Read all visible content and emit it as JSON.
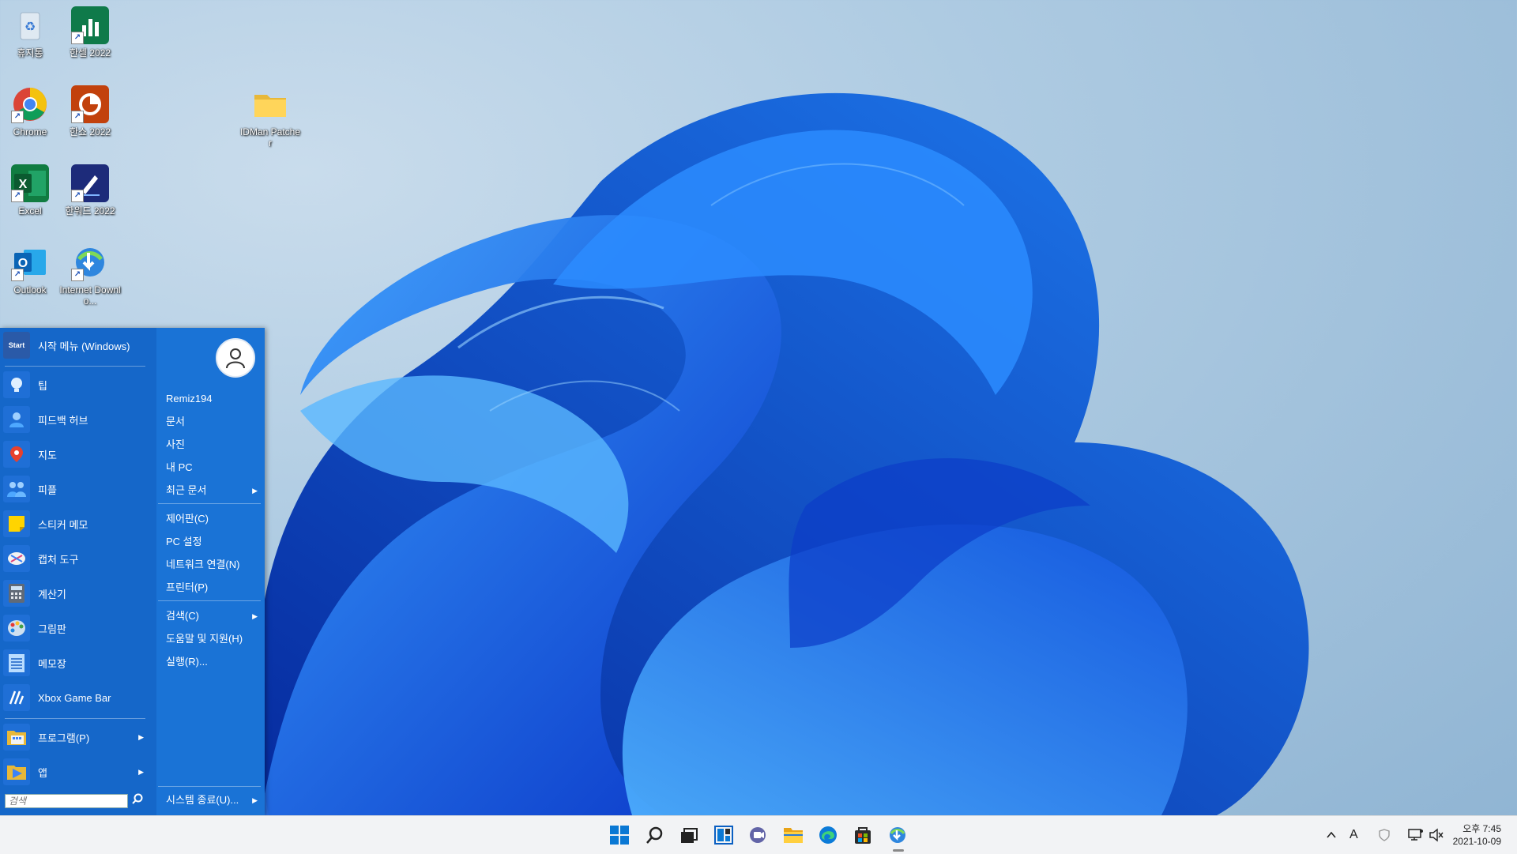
{
  "desktop": {
    "icons": [
      {
        "label": "휴지통",
        "icon": "recycle-bin-icon"
      },
      {
        "label": "한셀 2022",
        "icon": "hancell-icon"
      },
      {
        "label": "Chrome",
        "icon": "chrome-icon"
      },
      {
        "label": "한쇼 2022",
        "icon": "hanshow-icon"
      },
      {
        "label": "IDMan Patcher",
        "icon": "folder-icon"
      },
      {
        "label": "Excel",
        "icon": "excel-icon"
      },
      {
        "label": "한워드 2022",
        "icon": "hanword-icon"
      },
      {
        "label": "Outlook",
        "icon": "outlook-icon"
      },
      {
        "label": "Internet Downlo...",
        "icon": "idm-icon"
      }
    ]
  },
  "start_menu": {
    "header_label": "시작 메뉴 (Windows)",
    "header_icon_text": "Start",
    "apps": [
      {
        "label": "팁",
        "icon": "lightbulb-icon"
      },
      {
        "label": "피드백 허브",
        "icon": "feedback-person-icon"
      },
      {
        "label": "지도",
        "icon": "map-pin-icon"
      },
      {
        "label": "피플",
        "icon": "people-icon"
      },
      {
        "label": "스티커 메모",
        "icon": "sticky-note-icon"
      },
      {
        "label": "캡처 도구",
        "icon": "snipping-tool-icon"
      },
      {
        "label": "계산기",
        "icon": "calculator-icon"
      },
      {
        "label": "그림판",
        "icon": "paint-palette-icon"
      },
      {
        "label": "메모장",
        "icon": "notepad-icon"
      },
      {
        "label": "Xbox Game Bar",
        "icon": "xbox-game-bar-icon"
      }
    ],
    "programs_label": "프로그램(P)",
    "apps_label": "앱",
    "search_placeholder": "검색",
    "right_items": {
      "user": "Remiz194",
      "documents": "문서",
      "pictures": "사진",
      "my_pc": "내 PC",
      "recent_docs": "최근 문서",
      "control_panel": "제어판(C)",
      "pc_settings": "PC 설정",
      "network": "네트워크 연결(N)",
      "printers": "프린터(P)",
      "search": "검색(C)",
      "help": "도움말 및 지원(H)",
      "run": "실행(R)...",
      "shutdown": "시스템 종료(U)..."
    }
  },
  "taskbar": {
    "ime_label": "A",
    "clock_period_time": "오후 7:45",
    "clock_date": "2021-10-09"
  },
  "colors": {
    "start_bg": "#1567c9",
    "taskbar_bg": "#f2f3f5",
    "accent": "#0a63d8"
  }
}
